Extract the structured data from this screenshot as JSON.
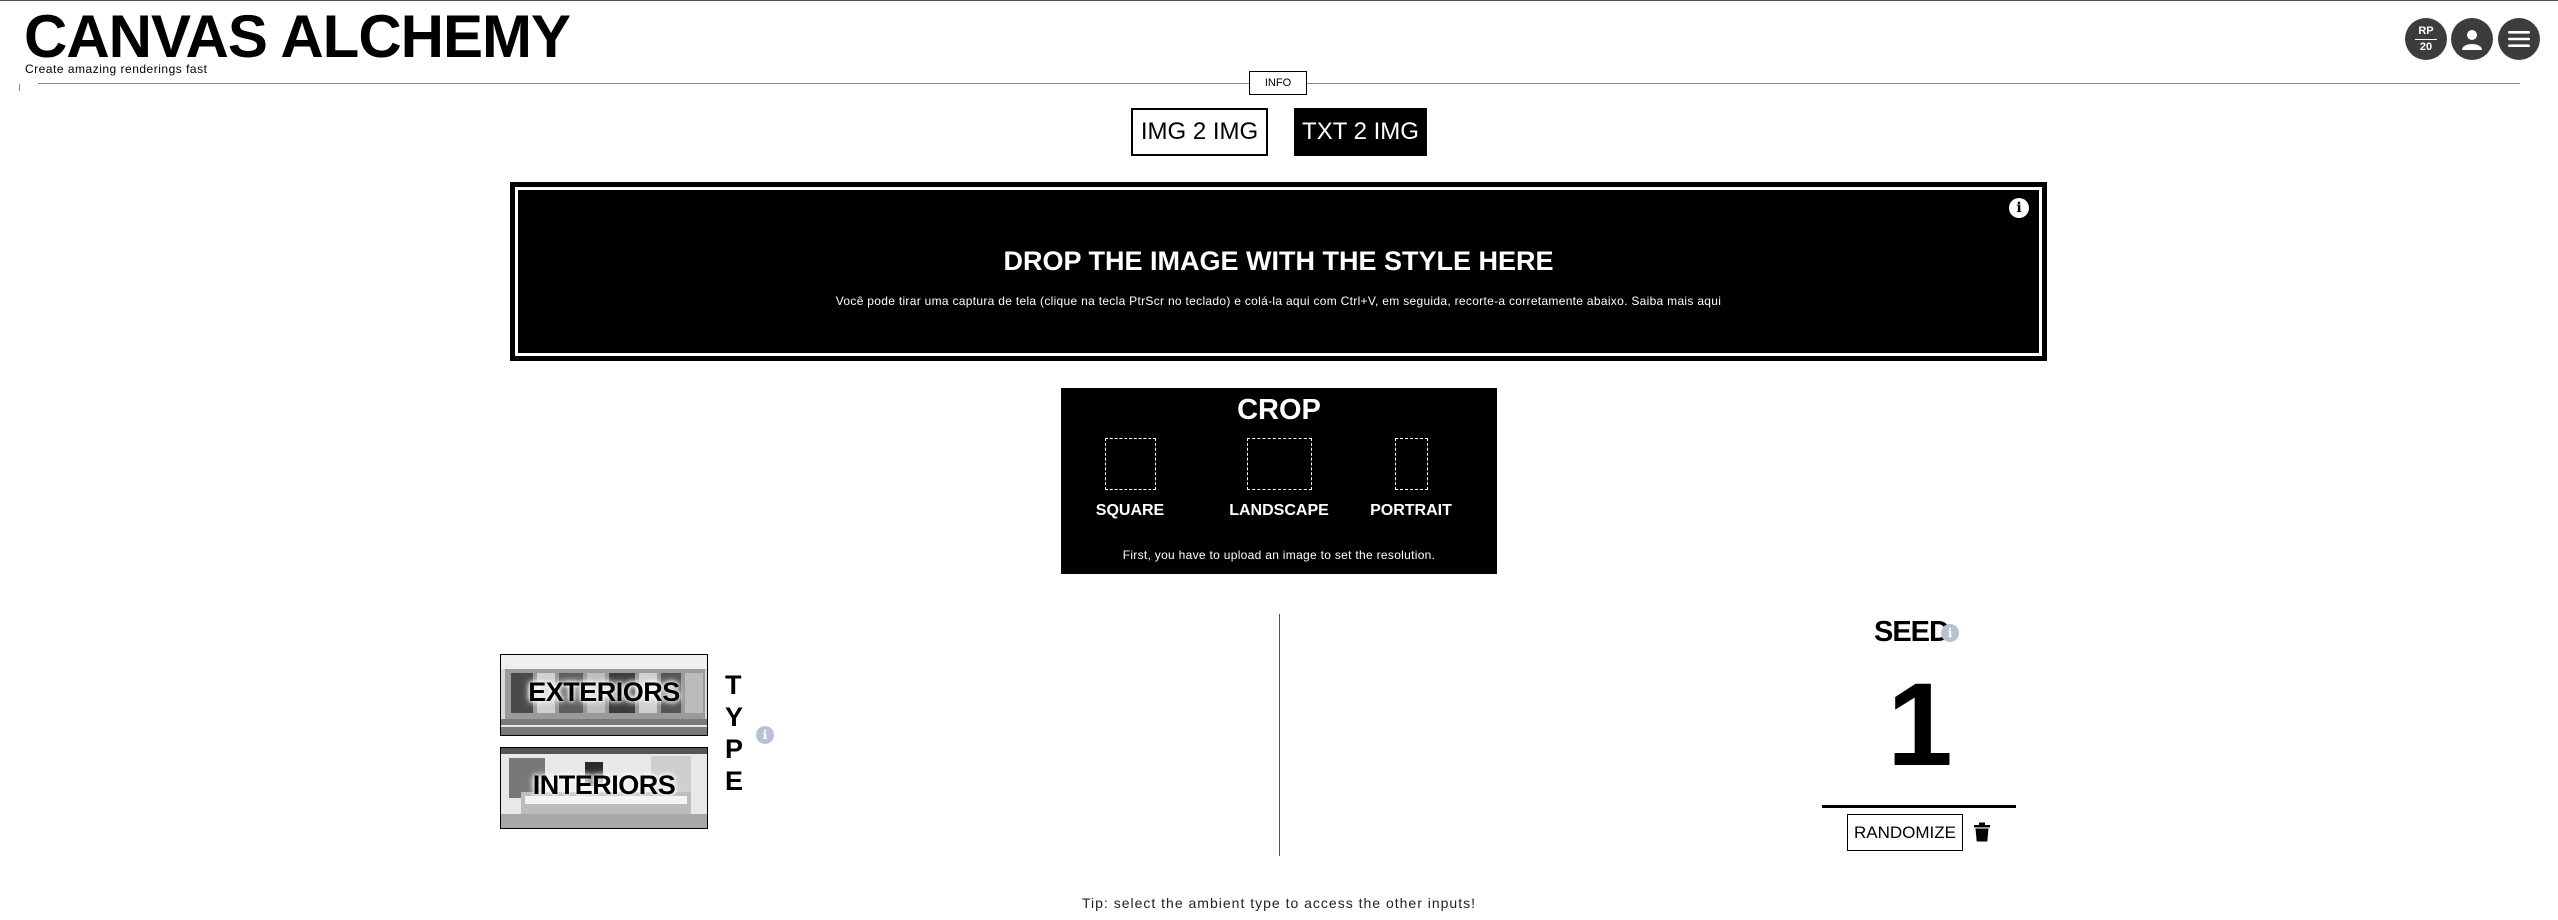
{
  "header": {
    "title": "CANVAS ALCHEMY",
    "subtitle": "Create amazing renderings fast",
    "info_label": "INFO",
    "credits_top": "RP",
    "credits_bottom": "20"
  },
  "mode_tabs": [
    {
      "label": "IMG 2 IMG",
      "active": false
    },
    {
      "label": "TXT 2 IMG",
      "active": true
    }
  ],
  "dropzone": {
    "title": "DROP THE IMAGE WITH THE STYLE HERE",
    "text": "Você pode tirar uma captura de tela (clique na tecla PtrScr no teclado) e colá-la aqui com Ctrl+V, em seguida, recorte-a corretamente abaixo. Saiba mais aqui"
  },
  "crop": {
    "title": "CROP",
    "options": [
      "SQUARE",
      "LANDSCAPE",
      "PORTRAIT"
    ],
    "note": "First, you have to upload an image to set the resolution."
  },
  "type": {
    "letters": [
      "T",
      "Y",
      "P",
      "E"
    ],
    "cards": [
      "EXTERIORS",
      "INTERIORS"
    ]
  },
  "seed": {
    "title": "SEED",
    "value": "1",
    "randomize_label": "RANDOMIZE"
  },
  "tip": "Tip: select the ambient type to access the other inputs!",
  "icons": {
    "info": "info-icon",
    "user": "user-icon",
    "menu": "hamburger-menu-icon",
    "trash": "trash-icon"
  }
}
